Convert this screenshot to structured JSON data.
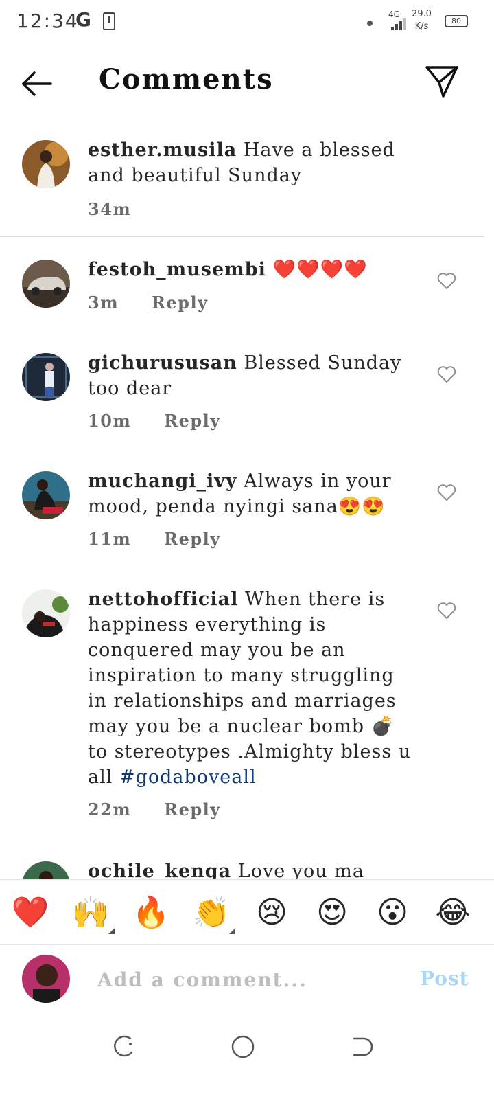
{
  "status_bar": {
    "time": "12:34",
    "carrier": "G",
    "network": "4G",
    "speed": "29.0",
    "speed_unit": "K/s",
    "battery": "80"
  },
  "header": {
    "title": "Comments"
  },
  "comments": [
    {
      "user": "esther.musila",
      "text": "Have a blessed and beautiful Sunday",
      "time": "34m"
    },
    {
      "user": "festoh_musembi",
      "text": "❤️❤️❤️❤️",
      "time": "3m",
      "reply": "Reply"
    },
    {
      "user": "gichurususan",
      "text": "Blessed Sunday too dear",
      "time": "10m",
      "reply": "Reply"
    },
    {
      "user": "muchangi_ivy",
      "text": "Always in your mood, penda nyingi sana😍😍",
      "time": "11m",
      "reply": "Reply"
    },
    {
      "user": "nettohofficial",
      "text": "When there is happiness everything is conquered may you be an inspiration to many struggling in relationships and marriages may you be a nuclear bomb 💣 to stereotypes .Almighty bless u all",
      "hashtag": "#godaboveall",
      "time": "22m",
      "reply": "Reply"
    },
    {
      "user": "ochile_kenga",
      "text": "Love you ma people"
    }
  ],
  "reactions": [
    "❤️",
    "🙌",
    "🔥",
    "👏",
    "😢",
    "😍",
    "😮",
    "😂"
  ],
  "composer": {
    "placeholder": "Add a comment...",
    "post_label": "Post"
  },
  "colors": {
    "accent_disabled": "#a8d8f5",
    "hashtag": "#0b3b7a",
    "heart": "#e0245e"
  }
}
